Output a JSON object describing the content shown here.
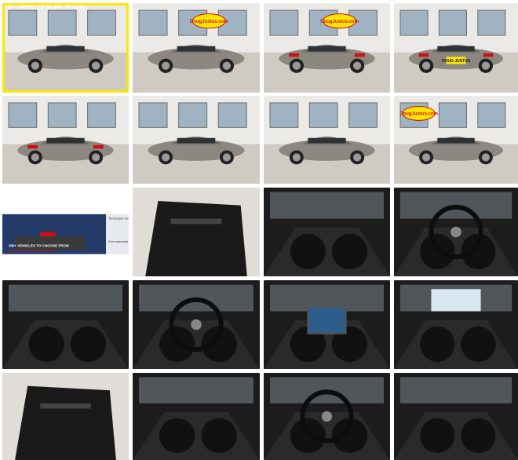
{
  "gallery": {
    "banner_text": "300 + VEHICLES $4,995 OR LESS",
    "logo_text": "DougJustus.com",
    "plate_text": "DOUG JUSTUS",
    "promo": {
      "headline": "300+ VEHICLES TO CHOOSE FROM",
      "sub": "100 VEHICLES $4,995 OR LESS",
      "side_top": "Tennessee Dealer",
      "side_mid": "Free warranty on most cars"
    },
    "colors": {
      "floor": "#cfcac2",
      "wall": "#eceae6",
      "car": "#8c8780",
      "logo_yellow": "#ffe600",
      "logo_red": "#d01010",
      "interior_dark": "#1c1c1c"
    },
    "photos": [
      {
        "name": "exterior-front-left",
        "scene": "exterior"
      },
      {
        "name": "exterior-side-left",
        "scene": "exterior"
      },
      {
        "name": "exterior-rear-left",
        "scene": "exterior"
      },
      {
        "name": "exterior-rear",
        "scene": "exterior"
      },
      {
        "name": "exterior-rear-quarter",
        "scene": "exterior"
      },
      {
        "name": "exterior-profile",
        "scene": "exterior"
      },
      {
        "name": "exterior-front-right",
        "scene": "exterior"
      },
      {
        "name": "exterior-front",
        "scene": "exterior"
      },
      {
        "name": "dealership-promo",
        "scene": "promo"
      },
      {
        "name": "driver-door-panel",
        "scene": "interior"
      },
      {
        "name": "front-seats",
        "scene": "interior"
      },
      {
        "name": "steering-wheel",
        "scene": "interior"
      },
      {
        "name": "front-interior-passenger",
        "scene": "interior"
      },
      {
        "name": "dashboard",
        "scene": "interior"
      },
      {
        "name": "infotainment-screen",
        "scene": "interior"
      },
      {
        "name": "sunroof",
        "scene": "interior"
      },
      {
        "name": "rear-door-panel",
        "scene": "interior"
      },
      {
        "name": "rear-seats",
        "scene": "interior"
      },
      {
        "name": "cabin-overview",
        "scene": "interior"
      },
      {
        "name": "rear-seat-detail",
        "scene": "interior"
      }
    ]
  }
}
